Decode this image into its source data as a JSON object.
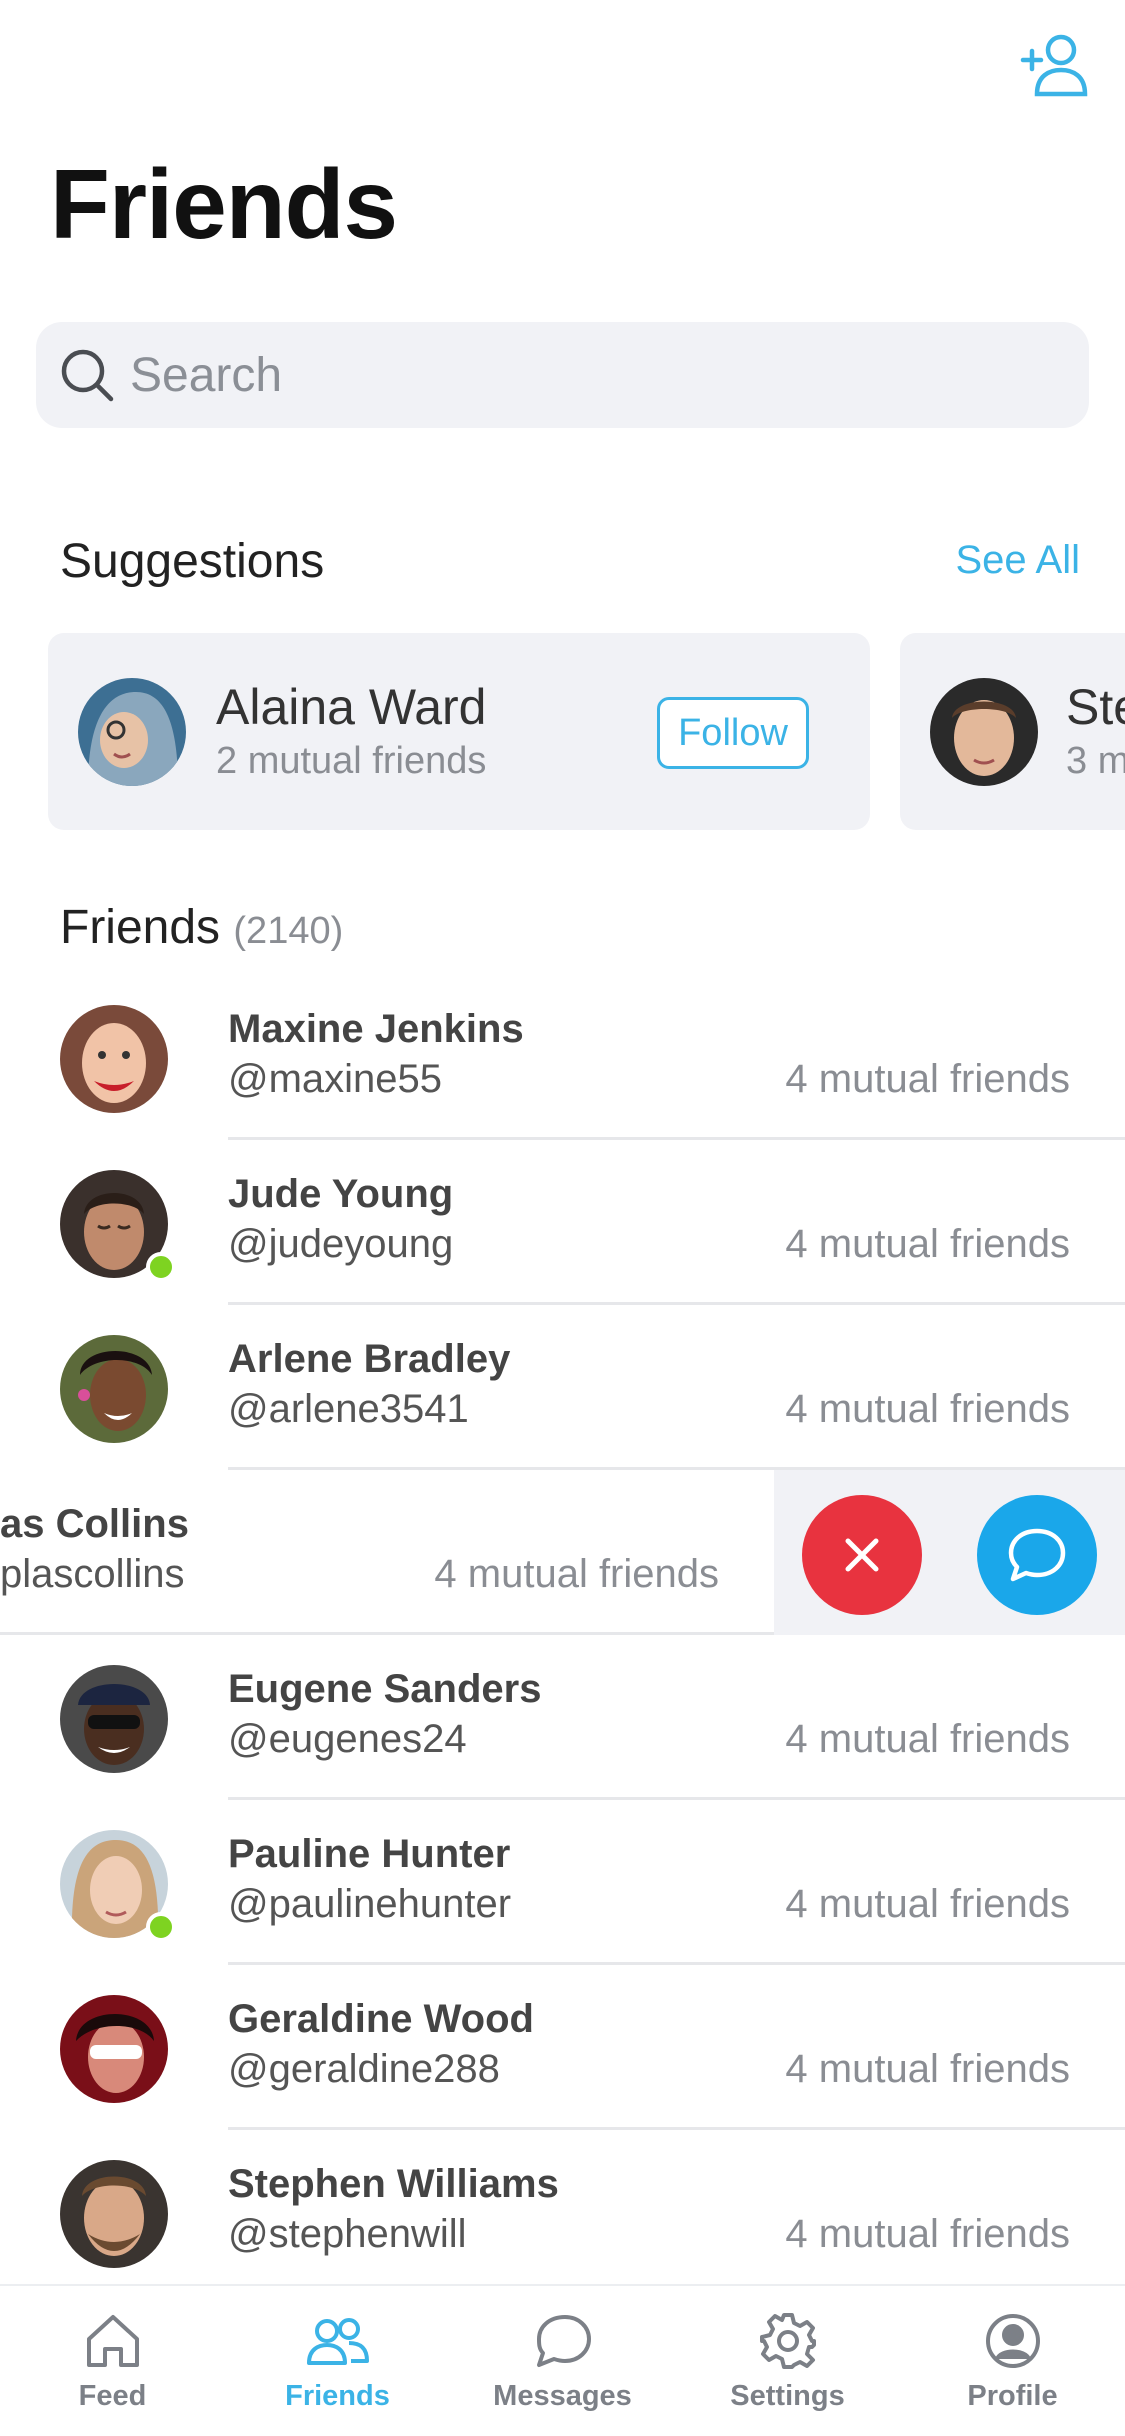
{
  "header": {
    "title": "Friends",
    "add_friend_icon": "add-user-icon"
  },
  "search": {
    "placeholder": "Search"
  },
  "suggestions": {
    "title": "Suggestions",
    "see_all": "See All",
    "cards": [
      {
        "name": "Alaina Ward",
        "mutual": "2 mutual friends",
        "follow_label": "Follow"
      },
      {
        "name": "Ste",
        "mutual": "3 m"
      }
    ]
  },
  "friends": {
    "title": "Friends",
    "count": "(2140)",
    "items": [
      {
        "name": "Maxine Jenkins",
        "handle": "@maxine55",
        "mutual": "4 mutual friends",
        "online": false
      },
      {
        "name": "Jude Young",
        "handle": "@judeyoung",
        "mutual": "4 mutual friends",
        "online": true
      },
      {
        "name": "Arlene Bradley",
        "handle": "@arlene3541",
        "mutual": "4 mutual friends",
        "online": false
      },
      {
        "name": "as Collins",
        "handle": "plascollins",
        "mutual": "4 mutual friends",
        "online": false
      },
      {
        "name": "Eugene Sanders",
        "handle": "@eugenes24",
        "mutual": "4 mutual friends",
        "online": false
      },
      {
        "name": "Pauline Hunter",
        "handle": "@paulinehunter",
        "mutual": "4 mutual friends",
        "online": true
      },
      {
        "name": "Geraldine Wood",
        "handle": "@geraldine288",
        "mutual": "4 mutual friends",
        "online": false
      },
      {
        "name": "Stephen Williams",
        "handle": "@stephenwill",
        "mutual": "4 mutual friends",
        "online": false
      }
    ]
  },
  "swipe_actions": {
    "remove_icon": "close-icon",
    "message_icon": "chat-bubble-icon"
  },
  "tab_bar": {
    "tabs": [
      {
        "label": "Feed",
        "icon": "home-icon",
        "active": false
      },
      {
        "label": "Friends",
        "icon": "friends-icon",
        "active": true
      },
      {
        "label": "Messages",
        "icon": "chat-bubble-icon",
        "active": false
      },
      {
        "label": "Settings",
        "icon": "gear-icon",
        "active": false
      },
      {
        "label": "Profile",
        "icon": "user-circle-icon",
        "active": false
      }
    ]
  },
  "colors": {
    "accent": "#3bb3e6",
    "remove": "#e8333f",
    "message": "#1aa7ea",
    "online": "#7ed321",
    "card_bg": "#f1f2f6"
  }
}
